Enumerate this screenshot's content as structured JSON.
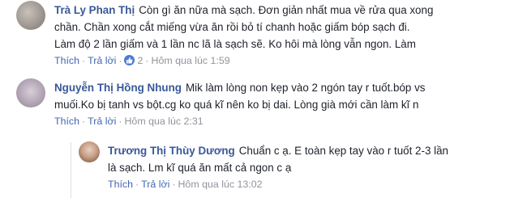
{
  "comments": [
    {
      "author": "Trà Ly Phan Thị",
      "lines": [
        "Còn gì ăn nữa mà sạch. Đơn giản nhất mua về rửa qua xong",
        "chần. Chần xong cắt miếng vừa ăn rồi bỏ tí chanh hoặc giấm bóp sạch đi.",
        "Làm độ 2 lần giấm và 1 lần nc lã là sạch sẽ. Ko hôi mà lòng vẫn ngon. Làm"
      ],
      "actions": {
        "like": "Thích",
        "reply": "Trả lời",
        "like_count": "2",
        "time": "Hôm qua lúc 1:59"
      }
    },
    {
      "author": "Nguyễn Thị Hồng Nhung",
      "lines": [
        "Mik làm lòng non kẹp vào 2 ngón tay r tuốt.bóp vs",
        "muối.Ko bị tanh vs bột.cg ko quá kĩ nên ko bị dai. Lòng già mới cần làm kĩ n"
      ],
      "actions": {
        "like": "Thích",
        "reply": "Trả lời",
        "time": "Hôm qua lúc 2:31"
      }
    },
    {
      "author": "Trương Thị Thùy Dương",
      "lines": [
        "Chuẩn c ạ. E toàn kẹp tay vào r tuốt 2-3 lần",
        "là sạch. Lm kĩ quá ăn mất cả ngon c ạ"
      ],
      "actions": {
        "like": "Thích",
        "reply": "Trả lời",
        "time": "Hôm qua lúc 13:02"
      }
    }
  ],
  "colors": {
    "name": "#385898",
    "link": "#4267b2",
    "meta": "#90949c",
    "text": "#1d2129",
    "like_badge": "#4a7bd5"
  },
  "icons": {
    "like_badge": "thumbs-up-icon"
  }
}
